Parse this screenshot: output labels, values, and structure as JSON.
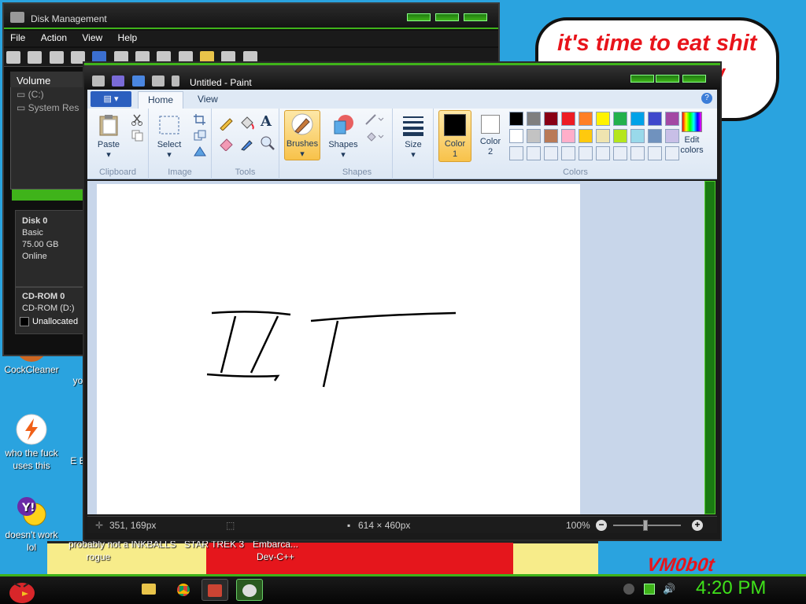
{
  "wallpaper": {
    "speech_text": "it's time to eat shit",
    "speech_partial": "ew",
    "signature": "VM0b0t"
  },
  "desktop_icons": [
    {
      "label": "CockCleaner"
    },
    {
      "label": "yo"
    },
    {
      "label": "who the fuck uses this"
    },
    {
      "label": "E E"
    },
    {
      "label": "doesn't work lol"
    },
    {
      "label": "probably not a rogue"
    },
    {
      "label": "INKBALLS"
    },
    {
      "label": "STAR TREK 3"
    },
    {
      "label": "Embarca... Dev-C++"
    }
  ],
  "disk_management": {
    "title": "Disk Management",
    "menu": [
      "File",
      "Action",
      "View",
      "Help"
    ],
    "volume_header": "Volume",
    "volumes": [
      "(C:)",
      "System Res"
    ],
    "disk0": {
      "name": "Disk 0",
      "type": "Basic",
      "size": "75.00 GB",
      "status": "Online"
    },
    "cdrom0": {
      "name": "CD-ROM 0",
      "type": "CD-ROM (D:)"
    },
    "legend_unallocated": "Unallocated"
  },
  "paint": {
    "title": "Untitled - Paint",
    "tabs": [
      "Home",
      "View"
    ],
    "groups": {
      "clipboard": "Clipboard",
      "image": "Image",
      "tools": "Tools",
      "shapes": "Shapes",
      "colors": "Colors"
    },
    "buttons": {
      "paste": "Paste",
      "select": "Select",
      "brushes": "Brushes",
      "shapes": "Shapes",
      "size": "Size",
      "color1": "Color 1",
      "color2": "Color 2",
      "edit_colors": "Edit colors"
    },
    "colors": {
      "color1": "#000000",
      "color2": "#ffffff",
      "palette_row1": [
        "#000000",
        "#7f7f7f",
        "#880015",
        "#ed1c24",
        "#ff7f27",
        "#fff200",
        "#22b14c",
        "#00a2e8",
        "#3f48cc",
        "#a349a4"
      ],
      "palette_row2": [
        "#ffffff",
        "#c3c3c3",
        "#b97a57",
        "#ffaec9",
        "#ffc90e",
        "#efe4b0",
        "#b5e61d",
        "#99d9ea",
        "#7092be",
        "#c8bfe7"
      ]
    },
    "status": {
      "cursor": "351, 169px",
      "size": "614 × 460px",
      "zoom": "100%"
    }
  },
  "taskbar": {
    "clock": "4:20 PM"
  }
}
